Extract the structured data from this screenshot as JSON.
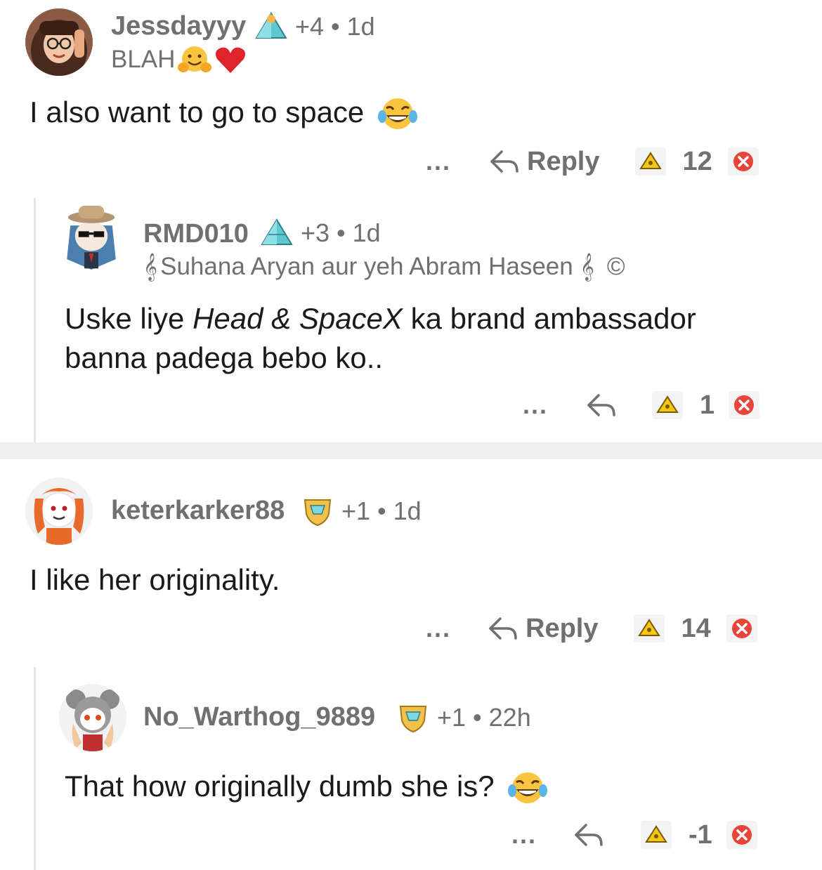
{
  "comments": [
    {
      "username": "Jessdayyy",
      "karma": "+4",
      "time": "1d",
      "flair": "BLAH",
      "body": "I also want to go to space",
      "reply_label": "Reply",
      "score": "12",
      "badge": "pyramid-icon"
    },
    {
      "username": "RMD010",
      "karma": "+3",
      "time": "1d",
      "flair": "Suhana Aryan aur yeh Abram Haseen",
      "body_prefix": "Uske liye ",
      "body_em": "Head & SpaceX",
      "body_suffix": " ka brand ambassador",
      "body_line2": "banna padega bebo ko..",
      "score": "1",
      "badge": "pyramid-icon"
    },
    {
      "username": "keterkarker88",
      "karma": "+1",
      "time": "1d",
      "body": "I like her originality.",
      "reply_label": "Reply",
      "score": "14",
      "badge": "shield-gem-icon"
    },
    {
      "username": "No_Warthog_9889",
      "karma": "+1",
      "time": "22h",
      "body": "That how originally dumb she is?",
      "score": "-1",
      "badge": "shield-gem-icon"
    }
  ],
  "separator": "•",
  "more_label": "...",
  "colors": {
    "meta": "#6f7072",
    "text": "#1a1a1b",
    "upvote_award": "#f5c518",
    "downvote_award": "#e8443a",
    "thread_line": "#e6e6e6",
    "divider": "#efefef"
  }
}
